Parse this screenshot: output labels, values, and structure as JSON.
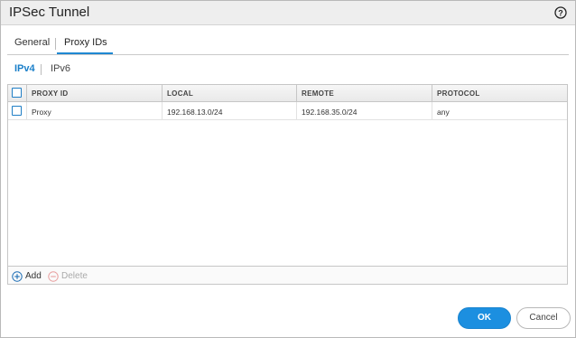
{
  "dialog": {
    "title": "IPSec Tunnel",
    "help_icon": "question-circle-icon"
  },
  "tabs": [
    {
      "label": "General",
      "active": false
    },
    {
      "label": "Proxy IDs",
      "active": true
    }
  ],
  "subtabs": [
    {
      "label": "IPv4",
      "active": true
    },
    {
      "label": "IPv6",
      "active": false
    }
  ],
  "grid": {
    "columns": [
      "PROXY ID",
      "LOCAL",
      "REMOTE",
      "PROTOCOL"
    ],
    "rows": [
      {
        "proxy_id": "Proxy",
        "local": "192.168.13.0/24",
        "remote": "192.168.35.0/24",
        "protocol": "any"
      }
    ]
  },
  "footer": {
    "add_label": "Add",
    "delete_label": "Delete"
  },
  "buttons": {
    "ok_label": "OK",
    "cancel_label": "Cancel"
  },
  "colors": {
    "accent": "#1f88d2",
    "ok_button": "#1c8fe0"
  }
}
